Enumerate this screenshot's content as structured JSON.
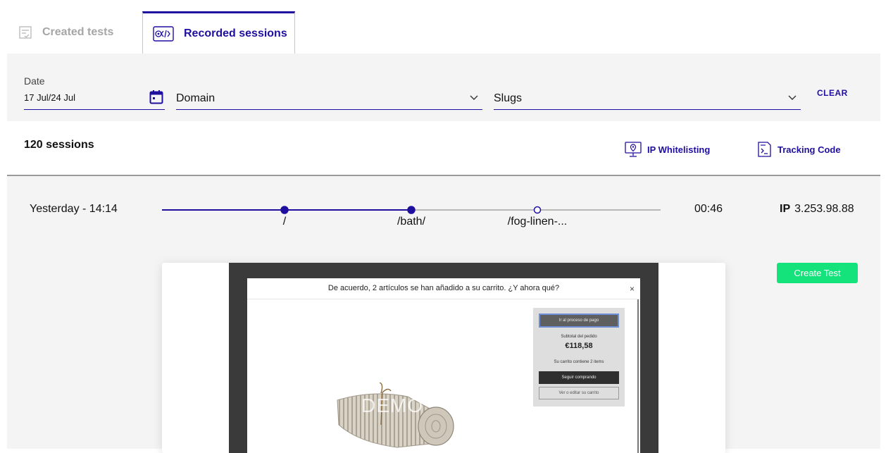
{
  "tabs": {
    "created": "Created tests",
    "recorded": "Recorded sessions"
  },
  "filters": {
    "date_label": "Date",
    "date_value": "17 Jul/24 Jul",
    "domain_placeholder": "Domain",
    "slugs_placeholder": "Slugs",
    "clear_label": "CLEAR"
  },
  "summary": {
    "sessions_count": "120 sessions",
    "ip_whitelisting": "IP Whitelisting",
    "tracking_code": "Tracking Code"
  },
  "session": {
    "time": "Yesterday - 14:14",
    "pages": [
      {
        "label": "/",
        "visited": true
      },
      {
        "label": "/bath/",
        "visited": true
      },
      {
        "label": "/fog-linen-...",
        "visited": false
      }
    ],
    "duration": "00:46",
    "ip_label": "IP",
    "ip_value": "3.253.98.88",
    "create_test_label": "Create Test"
  },
  "preview": {
    "modal_title": "De acuerdo, 2 artículos se han añadido a su carrito. ¿Y ahora qué?",
    "close": "×",
    "checkout": "Ir al proceso de pago",
    "subtotal_label": "Subtotal del pedido",
    "subtotal_value": "€118,58",
    "cart_count": "Su carrito contiene 2 items",
    "continue": "Seguir comprando",
    "edit_cart": "Ver o editar su carrito",
    "watermark": "DEMO"
  },
  "colors": {
    "accent": "#1f0f9e",
    "create_button": "#14e27a",
    "panel_bg": "#f4f4f4"
  },
  "icons": {
    "created_tab": "checklist-icon",
    "recorded_tab": "code-recording-icon",
    "date": "calendar-icon",
    "dropdown": "chevron-down-icon",
    "ip": "location-monitor-icon",
    "tracking": "code-document-icon"
  }
}
